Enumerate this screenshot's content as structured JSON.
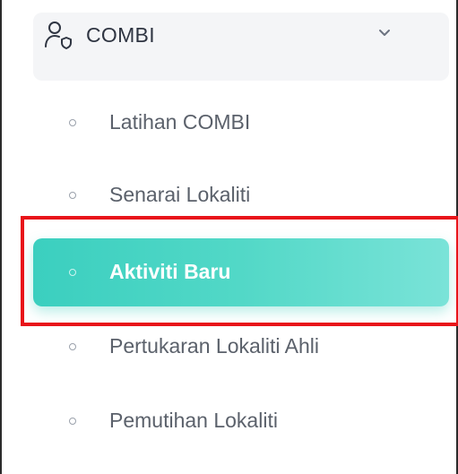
{
  "menu": {
    "group": {
      "label": "COMBI",
      "icon": "user-shield-icon",
      "chevron_icon": "chevron-down-icon"
    },
    "items": [
      {
        "label": "Latihan COMBI",
        "active": false
      },
      {
        "label": "Senarai Lokaliti",
        "active": false
      },
      {
        "label": "Aktiviti Baru",
        "active": true
      },
      {
        "label": "Pertukaran Lokaliti Ahli",
        "active": false
      },
      {
        "label": "Pemutihan Lokaliti",
        "active": false
      }
    ]
  },
  "colors": {
    "active_gradient_start": "#3bcfbf",
    "active_gradient_end": "#7ae3d8",
    "highlight_border": "#e8141a",
    "group_background": "#f4f5f7",
    "item_text": "#5b616b"
  }
}
